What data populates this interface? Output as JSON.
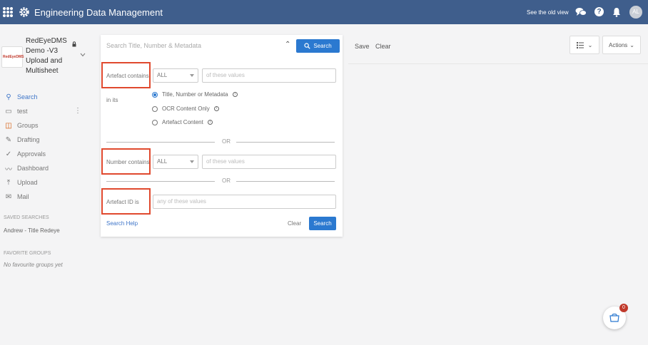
{
  "header": {
    "app_title": "Engineering Data Management",
    "old_view_link": "See the old view",
    "help_label": "?",
    "user_initials": "AL"
  },
  "sidebar": {
    "logo_text": "RedEyeDMS",
    "project_name": "RedEyeDMS Demo -V3 Upload and Multisheet",
    "nav_items": [
      {
        "label": "Search",
        "icon": "search-icon"
      },
      {
        "label": "test",
        "icon": "folder-icon"
      },
      {
        "label": "Groups",
        "icon": "groups-icon"
      },
      {
        "label": "Drafting",
        "icon": "pencil-icon"
      },
      {
        "label": "Approvals",
        "icon": "check-icon"
      },
      {
        "label": "Dashboard",
        "icon": "chart-line-icon"
      },
      {
        "label": "Upload",
        "icon": "upload-icon"
      },
      {
        "label": "Mail",
        "icon": "mail-icon"
      }
    ],
    "saved_searches_label": "SAVED SEARCHES",
    "saved_searches": [
      "Andrew - Title Redeye"
    ],
    "favorite_groups_label": "FAVORITE GROUPS",
    "favorite_groups_empty": "No favourite groups yet"
  },
  "search_panel": {
    "search_placeholder": "Search Title, Number & Metadata",
    "search_button": "Search",
    "artefact_contains_label": "Artefact contains",
    "artefact_select": "ALL",
    "artefact_values_placeholder": "of these values",
    "in_its_label": "in its",
    "radio_options": [
      {
        "label": "Title, Number or Metadata",
        "selected": true
      },
      {
        "label": "OCR Content Only",
        "selected": false
      },
      {
        "label": "Artefact Content",
        "selected": false
      }
    ],
    "or_label_1": "OR",
    "number_contains_label": "Number contains",
    "number_select": "ALL",
    "number_values_placeholder": "of these values",
    "or_label_2": "OR",
    "artefact_id_label": "Artefact ID is",
    "artefact_id_placeholder": "any of these values",
    "search_help": "Search Help",
    "clear_label": "Clear",
    "search_button_bottom": "Search"
  },
  "toolbar": {
    "save_label": "Save",
    "clear_label": "Clear",
    "actions_label": "Actions"
  },
  "cart": {
    "badge_count": "0"
  },
  "colors": {
    "header_bg": "#3f5e8c",
    "primary": "#2b79d0",
    "highlight": "#e0492e",
    "badge": "#c0392b"
  }
}
